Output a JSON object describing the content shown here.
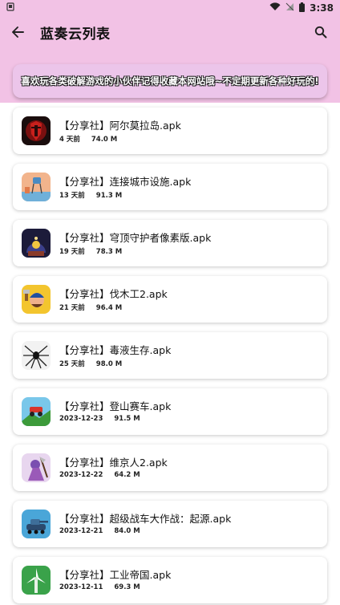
{
  "status_bar": {
    "carrier_icon": "sim-alert-icon",
    "time": "3:38"
  },
  "app_bar": {
    "title": "蓝奏云列表"
  },
  "banner": {
    "text": "喜欢玩各类破解游戏的小伙伴记得收藏本网站哦~不定期更新各种好玩的!"
  },
  "files": [
    {
      "name": "【分享社】阿尔莫拉岛.apk",
      "date": "4 天前",
      "size": "74.0 M",
      "icon": "red-knight-icon"
    },
    {
      "name": "【分享社】连接城市设施.apk",
      "date": "13 天前",
      "size": "91.3 M",
      "icon": "water-tower-icon"
    },
    {
      "name": "【分享社】穹顶守护者像素版.apk",
      "date": "19 天前",
      "size": "78.3 M",
      "icon": "dome-guardian-icon"
    },
    {
      "name": "【分享社】伐木工2.apk",
      "date": "21 天前",
      "size": "96.4 M",
      "icon": "lumberjack-icon"
    },
    {
      "name": "【分享社】毒液生存.apk",
      "date": "25 天前",
      "size": "98.0 M",
      "icon": "spider-icon"
    },
    {
      "name": "【分享社】登山赛车.apk",
      "date": "2023-12-23",
      "size": "91.5 M",
      "icon": "hill-climb-car-icon"
    },
    {
      "name": "【分享社】维京人2.apk",
      "date": "2023-12-22",
      "size": "64.2 M",
      "icon": "viking-icon"
    },
    {
      "name": "【分享社】超级战车大作战：起源.apk",
      "date": "2023-12-21",
      "size": "84.0 M",
      "icon": "tank-icon"
    },
    {
      "name": "【分享社】工业帝国.apk",
      "date": "2023-12-11",
      "size": "69.3 M",
      "icon": "windmill-icon"
    }
  ]
}
